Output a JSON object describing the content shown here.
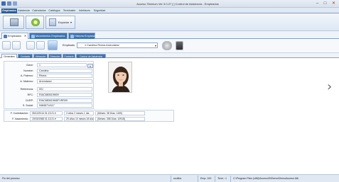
{
  "window": {
    "title": "Acceso Tiberium  Ver 3.0.27 [ ] Control de Asistencia - Empleados"
  },
  "menu": {
    "tabs": [
      "Empleados",
      "Asistencia",
      "Calendarios",
      "Catálogos",
      "Terminales",
      "Interfaces",
      "Seguridad"
    ]
  },
  "ribbon": {
    "dropdown_label": "Exportar"
  },
  "doc_tabs": [
    "Empleados",
    "Movimientos Empleados",
    "Historia Empleados"
  ],
  "toolbar": {
    "employee_label": "Empleado",
    "employee_value": "1 Carolina Rivera Arrendarez"
  },
  "sub_tabs": [
    "Generales",
    "Contacto",
    "Ubicación",
    "Dirección",
    "Contacto",
    "Control de Asistencia"
  ],
  "form": {
    "fields": [
      {
        "label": "Clave:",
        "value": "1"
      },
      {
        "label": "Nombre:",
        "value": "Carolina"
      },
      {
        "label": "A. Paterno:",
        "value": "Rivera"
      },
      {
        "label": "A. Materno:",
        "value": "Arrendarez"
      },
      {
        "label": "Referencia:",
        "value": "001"
      },
      {
        "label": "RFC:",
        "value": "RIAC880619M09"
      },
      {
        "label": "CURP:",
        "value": "RIAC880619MDFVRR09"
      },
      {
        "label": "S. Social:",
        "value": "94846714117"
      }
    ]
  },
  "dates": [
    {
      "label": "F. Contratación:",
      "date": "05/12/2014 01:13:21 ▾",
      "age": "3 años  2 meses  1 día",
      "info": "(Meses: 38  Días: 1159)"
    },
    {
      "label": "F. Nacimiento:",
      "date": "19/03/1988 01:13:21 ▾",
      "age": "29 años 10 meses 18 días",
      "info": "(Meses: 358  Días: 10918)"
    }
  ],
  "status": {
    "left": "Fin del proceso",
    "user": "sculiba",
    "company": "Emp: 100",
    "terminal": "Term.: 1",
    "path": "C:\\Program Files (x86)\\Acceso30\\Demo\\DemoAcceso.fdb"
  },
  "colors": {
    "accent": "#2e5e9a",
    "tab_inactive": "#3c73b5"
  }
}
